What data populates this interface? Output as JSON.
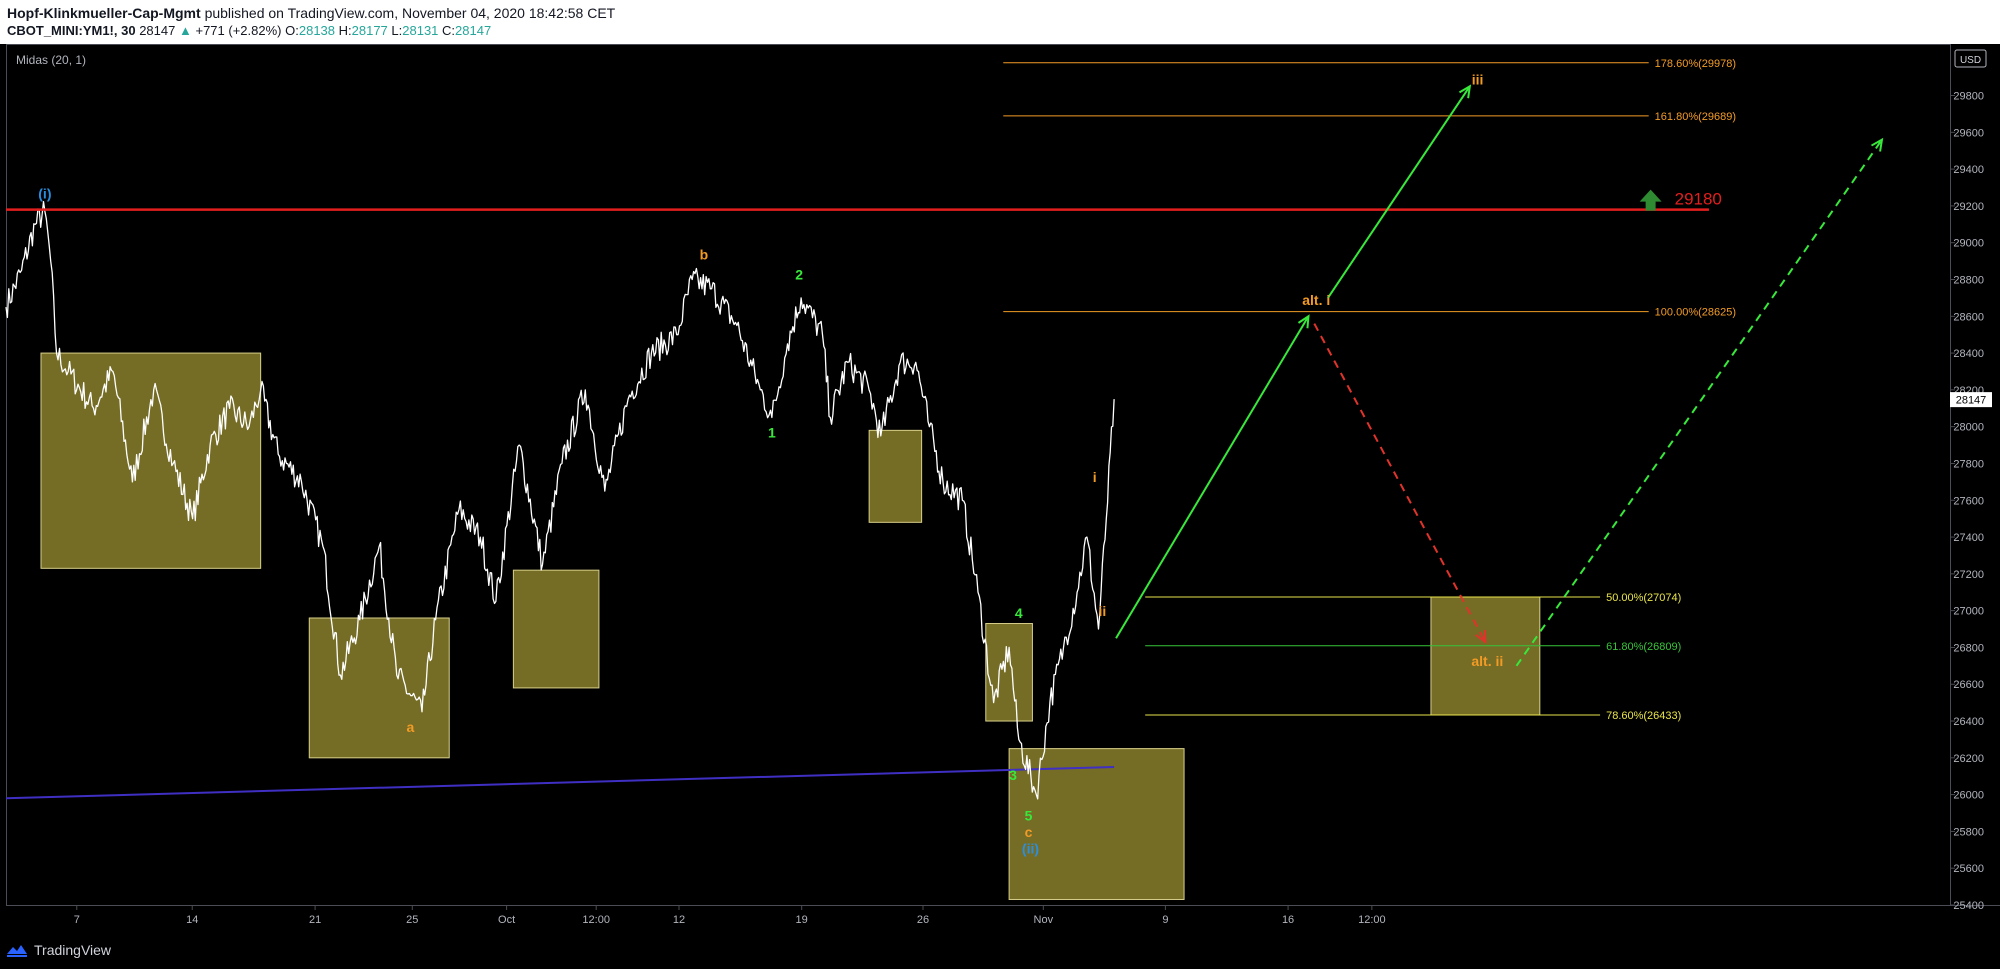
{
  "header": {
    "author": "Hopf-Klinkmueller-Cap-Mgmt",
    "published": "published on TradingView.com, November 04, 2020 18:42:58 CET",
    "symbol": "CBOT_MINI:YM1!, 30",
    "last": "28147",
    "change_arrow": "▲",
    "change": "+771 (+2.82%)",
    "o_label": "O:",
    "o_value": "28138",
    "h_label": "H:",
    "h_value": "28177",
    "l_label": "L:",
    "l_value": "28131",
    "c_label": "C:",
    "c_value": "28147"
  },
  "indicator_label": "Midas (20, 1)",
  "currency": "USD",
  "last_price_tag": "28147",
  "footer": {
    "brand": "TradingView"
  },
  "colors": {
    "background": "#000000",
    "price": "#ffffff",
    "midas": "#3f2fc2",
    "box_fill": "#8a7f2d",
    "resistance": "#e31e1e",
    "wave_orange": "#f29b25",
    "wave_green": "#38e83b",
    "wave_blue": "#2a8fe0",
    "fib_yellow": "#e8e44a",
    "fib_green": "#37c43a",
    "fib_orange": "#f29b25",
    "axis_text": "#b2b5be"
  },
  "chart_data": {
    "type": "line",
    "symbol": "CBOT_MINI:YM1!",
    "interval": "30",
    "y_axis": {
      "ylim": [
        25400,
        30080
      ],
      "ticks": [
        25400,
        25600,
        25800,
        26000,
        26200,
        26400,
        26600,
        26800,
        27000,
        27200,
        27400,
        27600,
        27800,
        28000,
        28200,
        28400,
        28600,
        28800,
        29000,
        29200,
        29400,
        29600,
        29800
      ]
    },
    "x_axis": {
      "xlim": [
        0,
        100
      ],
      "ticks": [
        {
          "x": 3.64,
          "label": "7"
        },
        {
          "x": 9.58,
          "label": "14"
        },
        {
          "x": 15.9,
          "label": "21"
        },
        {
          "x": 20.9,
          "label": "25"
        },
        {
          "x": 25.75,
          "label": "Oct"
        },
        {
          "x": 30.36,
          "label": "12:00"
        },
        {
          "x": 34.62,
          "label": "12"
        },
        {
          "x": 40.93,
          "label": "19"
        },
        {
          "x": 47.17,
          "label": "26"
        },
        {
          "x": 53.36,
          "label": "Nov"
        },
        {
          "x": 59.64,
          "label": "9"
        },
        {
          "x": 65.95,
          "label": "16"
        },
        {
          "x": 70.26,
          "label": "12:00"
        }
      ]
    },
    "price_series": {
      "name": "YM1!",
      "points": [
        [
          0,
          28650
        ],
        [
          0.8,
          28850
        ],
        [
          1.5,
          29100
        ],
        [
          2.0,
          29170
        ],
        [
          2.3,
          28900
        ],
        [
          2.6,
          28400
        ],
        [
          3.2,
          28300
        ],
        [
          4.5,
          28100
        ],
        [
          5.5,
          28300
        ],
        [
          6.5,
          27700
        ],
        [
          7.6,
          28200
        ],
        [
          8.6,
          27800
        ],
        [
          9.6,
          27500
        ],
        [
          10.5,
          27900
        ],
        [
          11.5,
          28100
        ],
        [
          12.5,
          28000
        ],
        [
          13.1,
          28200
        ],
        [
          14.0,
          27850
        ],
        [
          15.2,
          27700
        ],
        [
          16.3,
          27350
        ],
        [
          17.2,
          26650
        ],
        [
          18.2,
          26950
        ],
        [
          19.2,
          27350
        ],
        [
          20.1,
          26650
        ],
        [
          21.4,
          26450
        ],
        [
          22.1,
          26950
        ],
        [
          23.3,
          27550
        ],
        [
          24.4,
          27400
        ],
        [
          25.2,
          27050
        ],
        [
          26.4,
          27900
        ],
        [
          27.6,
          27250
        ],
        [
          28.6,
          27800
        ],
        [
          29.8,
          28200
        ],
        [
          30.8,
          27650
        ],
        [
          32.0,
          28150
        ],
        [
          33.2,
          28400
        ],
        [
          34.5,
          28500
        ],
        [
          35.3,
          28800
        ],
        [
          36.3,
          28750
        ],
        [
          37.6,
          28550
        ],
        [
          38.8,
          28200
        ],
        [
          39.4,
          28050
        ],
        [
          40.2,
          28450
        ],
        [
          40.9,
          28700
        ],
        [
          42.0,
          28500
        ],
        [
          42.4,
          28050
        ],
        [
          43.3,
          28350
        ],
        [
          44.4,
          28200
        ],
        [
          45.0,
          27950
        ],
        [
          46.0,
          28350
        ],
        [
          46.8,
          28350
        ],
        [
          47.5,
          28000
        ],
        [
          48.2,
          27700
        ],
        [
          49.2,
          27600
        ],
        [
          50.0,
          27100
        ],
        [
          50.8,
          26500
        ],
        [
          51.6,
          26800
        ],
        [
          52.1,
          26300
        ],
        [
          53.0,
          26000
        ],
        [
          53.7,
          26500
        ],
        [
          54.4,
          26800
        ],
        [
          55.1,
          27100
        ],
        [
          55.6,
          27400
        ],
        [
          56.2,
          26900
        ],
        [
          56.6,
          27500
        ],
        [
          57.0,
          28150
        ]
      ]
    },
    "midas_series": {
      "name": "Midas (20, 1)",
      "points": [
        [
          0,
          25980
        ],
        [
          57.0,
          26150
        ]
      ]
    },
    "zones": [
      {
        "x": [
          1.8,
          13.1
        ],
        "y": [
          27230,
          28400
        ]
      },
      {
        "x": [
          15.6,
          22.8
        ],
        "y": [
          26200,
          26960
        ]
      },
      {
        "x": [
          26.1,
          30.5
        ],
        "y": [
          26580,
          27220
        ]
      },
      {
        "x": [
          44.4,
          47.1
        ],
        "y": [
          27480,
          27980
        ]
      },
      {
        "x": [
          50.4,
          52.8
        ],
        "y": [
          26400,
          26930
        ]
      },
      {
        "x": [
          51.6,
          60.6
        ],
        "y": [
          25430,
          26250
        ]
      },
      {
        "x": [
          73.3,
          78.9
        ],
        "y": [
          26433,
          27074
        ]
      }
    ],
    "resistance": {
      "value": 29180,
      "label": "29180",
      "x": [
        0,
        87.6
      ]
    },
    "fib_levels": [
      {
        "label": "178.60%(29978)",
        "value": 29978,
        "x": [
          51.3,
          84.5
        ],
        "color": "orange"
      },
      {
        "label": "161.80%(29689)",
        "value": 29689,
        "x": [
          51.3,
          84.5
        ],
        "color": "orange"
      },
      {
        "label": "100.00%(28625)",
        "value": 28625,
        "x": [
          51.3,
          84.5
        ],
        "color": "orange"
      },
      {
        "label": "50.00%(27074)",
        "value": 27074,
        "x": [
          58.6,
          82.0
        ],
        "color": "yellow"
      },
      {
        "label": "61.80%(26809)",
        "value": 26809,
        "x": [
          58.6,
          82.0
        ],
        "color": "green"
      },
      {
        "label": "78.60%(26433)",
        "value": 26433,
        "x": [
          58.6,
          82.0
        ],
        "color": "yellow"
      }
    ],
    "projections": [
      {
        "from": [
          57.1,
          26850
        ],
        "to": [
          67.0,
          28600
        ],
        "color": "green",
        "style": "solid"
      },
      {
        "from": [
          68.0,
          28700
        ],
        "to": [
          75.3,
          29850
        ],
        "color": "green",
        "style": "solid"
      },
      {
        "from": [
          67.3,
          28560
        ],
        "to": [
          76.1,
          26830
        ],
        "color": "red",
        "style": "dashed"
      },
      {
        "from": [
          77.7,
          26700
        ],
        "to": [
          96.5,
          29560
        ],
        "color": "green",
        "style": "dashed"
      }
    ],
    "wave_labels": [
      {
        "text": "(i)",
        "x": 2.0,
        "y": 29240,
        "color": "blue"
      },
      {
        "text": "a",
        "x": 20.8,
        "y": 26340,
        "color": "orange"
      },
      {
        "text": "b",
        "x": 35.9,
        "y": 28910,
        "color": "orange"
      },
      {
        "text": "1",
        "x": 39.4,
        "y": 27940,
        "color": "green"
      },
      {
        "text": "2",
        "x": 40.8,
        "y": 28800,
        "color": "green"
      },
      {
        "text": "4",
        "x": 52.1,
        "y": 26960,
        "color": "green"
      },
      {
        "text": "3",
        "x": 51.8,
        "y": 26080,
        "color": "green"
      },
      {
        "text": "5",
        "x": 52.6,
        "y": 25860,
        "color": "green"
      },
      {
        "text": "c",
        "x": 52.6,
        "y": 25770,
        "color": "orange"
      },
      {
        "text": "(ii)",
        "x": 52.7,
        "y": 25680,
        "color": "blue"
      },
      {
        "text": "i",
        "x": 56.0,
        "y": 27700,
        "color": "orange"
      },
      {
        "text": "ii",
        "x": 56.4,
        "y": 26970,
        "color": "orange"
      },
      {
        "text": "iii",
        "x": 75.7,
        "y": 29860,
        "color": "orange"
      },
      {
        "text": "alt. i",
        "x": 67.4,
        "y": 28660,
        "color": "orange"
      },
      {
        "text": "alt. ii",
        "x": 76.2,
        "y": 26700,
        "color": "orange"
      }
    ]
  }
}
